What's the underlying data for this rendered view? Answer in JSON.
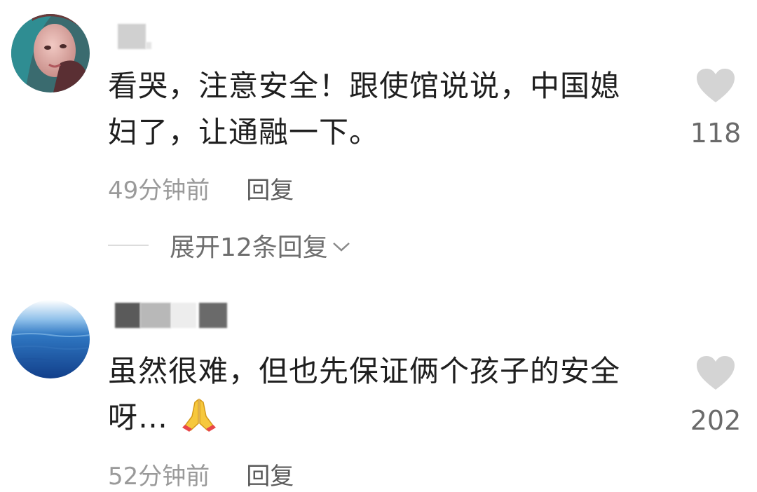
{
  "comments": [
    {
      "text_line1": "看哭，注意安全！跟使馆说说，中国媳",
      "text_line2": "妇了，让通融一下。",
      "time": "49分钟前",
      "reply_label": "回复",
      "likes": "118",
      "expand_label": "展开12条回复"
    },
    {
      "text_line1": "虽然很难，但也先保证俩个孩子的安全",
      "text_line2": "呀…",
      "emoji": "praying-hands-icon",
      "time": "52分钟前",
      "reply_label": "回复",
      "likes": "202"
    }
  ],
  "colors": {
    "text": "#1f1f1f",
    "meta": "#9a9a9a",
    "heart": "#d4d4d4",
    "count": "#6a6a6a"
  }
}
